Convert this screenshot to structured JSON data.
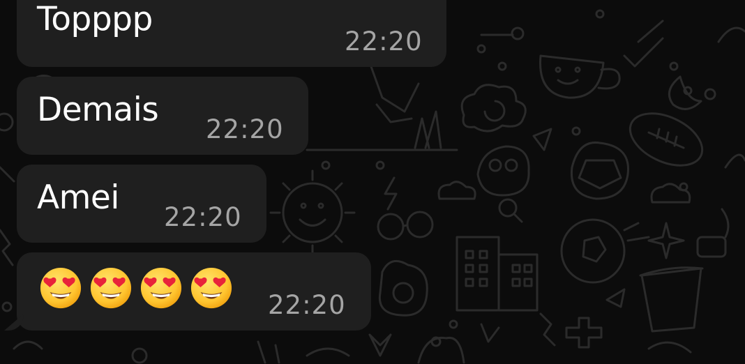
{
  "theme": {
    "background": "#0c0c0c",
    "bubble_color": "#1f1f1f",
    "text_color": "#ffffff",
    "time_color": "#a5a5a5",
    "doodle_color": "#2b2b2b"
  },
  "messages": [
    {
      "text": "Topppp",
      "time": "22:20"
    },
    {
      "text": "Demais",
      "time": "22:20"
    },
    {
      "text": "Amei",
      "time": "22:20"
    },
    {
      "text": "😍😍😍😍",
      "time": "22:20",
      "emoji_icon": "heart-eyes-emoji",
      "emoji_count": 4
    }
  ]
}
